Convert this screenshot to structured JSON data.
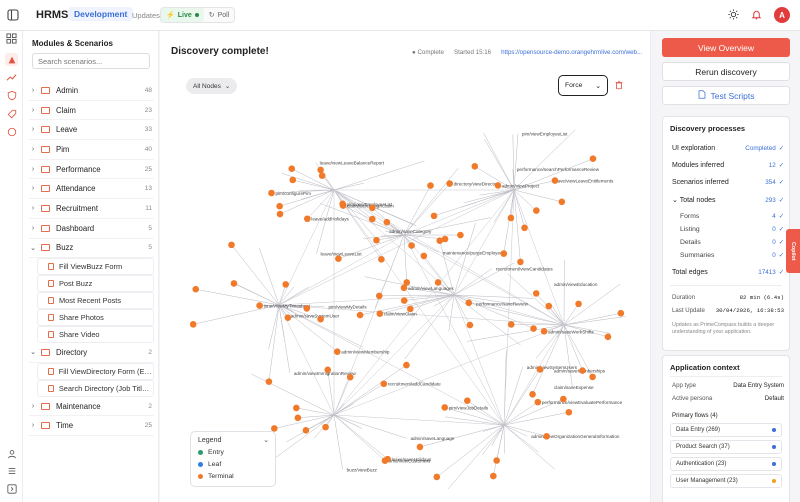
{
  "app": {
    "brand": "HRMS",
    "env": "Development",
    "updates_label": "Updates:",
    "live_label": "Live",
    "poll_label": "Poll",
    "avatar_initial": "A"
  },
  "sidebar": {
    "title": "Modules & Scenarios",
    "search_placeholder": "Search scenarios...",
    "modules": [
      {
        "name": "Admin",
        "count": "48",
        "expanded": false
      },
      {
        "name": "Claim",
        "count": "23",
        "expanded": false
      },
      {
        "name": "Leave",
        "count": "33",
        "expanded": false
      },
      {
        "name": "Pim",
        "count": "40",
        "expanded": false
      },
      {
        "name": "Performance",
        "count": "25",
        "expanded": false
      },
      {
        "name": "Attendance",
        "count": "13",
        "expanded": false
      },
      {
        "name": "Recruitment",
        "count": "11",
        "expanded": false
      },
      {
        "name": "Dashboard",
        "count": "5",
        "expanded": false
      },
      {
        "name": "Buzz",
        "count": "5",
        "expanded": true,
        "scenarios": [
          "Fill ViewBuzz Form",
          "Post Buzz",
          "Most Recent Posts",
          "Share Photos",
          "Share Video"
        ]
      },
      {
        "name": "Directory",
        "count": "2",
        "expanded": true,
        "scenarios": [
          "Fill ViewDirectory Form (Emp...",
          "Search Directory (Job Title, ..."
        ]
      },
      {
        "name": "Maintenance",
        "count": "2",
        "expanded": false
      },
      {
        "name": "Time",
        "count": "25",
        "expanded": false
      }
    ]
  },
  "main": {
    "title": "Discovery complete!",
    "status": "Complete",
    "started": "Started 15:16",
    "url": "https://opensource-demo.orangehrmlive.com/web...",
    "nodes_filter": "All Nodes",
    "layout": "Force",
    "legend": {
      "title": "Legend",
      "items": [
        {
          "label": "Entry",
          "color": "#2a9d6f"
        },
        {
          "label": "Leaf",
          "color": "#2f7fe0"
        },
        {
          "label": "Terminal",
          "color": "#f07a2a"
        }
      ]
    },
    "graph_labels": [
      "pim/configurePim",
      "leave/viewLeaveList",
      "pim/viewEmployeeList",
      "leave/viewLeaveBalanceReport",
      "leave/addHolidays",
      "pim/viewEmployeeList",
      "leave/viewLeaveEntitlements",
      "performance/searchPerformanceReview",
      "admin/viewProject",
      "pim/viewMyDetails",
      "admin/viewMembership",
      "admin/viewImmigrationReview",
      "time/viewMyTimesheet",
      "admin/saveSystemUser",
      "claim/viewClaim",
      "performance/saveReview",
      "admin/viewLanguages",
      "recruitment/viewCandidates",
      "admin/saveWorkShifts",
      "admin/viewEducation",
      "admin/saveMemberships",
      "claim/saveExpense",
      "recruitment/addCandidate",
      "admin/saveLanguage",
      "leave/saveHolidays",
      "buzz/viewBuzz",
      "time/viewCustomers",
      "admin/viewSystemUsers",
      "pim/viewJobDetails",
      "admin/viewOrganizationGeneralInformation",
      "performance/viewEvaluatePerformance",
      "admin/saveCategory",
      "claim/viewAssignClaim",
      "maintenance/purgeEmployee",
      "directory/viewDirectory"
    ]
  },
  "right": {
    "view_overview": "View Overview",
    "rerun": "Rerun discovery",
    "test_scripts": "Test Scripts",
    "processes_title": "Discovery processes",
    "ui_exploration_label": "UI exploration",
    "ui_exploration_value": "Completed",
    "modules_label": "Modules inferred",
    "modules_value": "12",
    "scenarios_label": "Scenarios inferred",
    "scenarios_value": "354",
    "total_nodes_label": "Total nodes",
    "total_nodes_value": "293",
    "forms_label": "Forms",
    "forms_value": "4",
    "listing_label": "Listing",
    "listing_value": "0",
    "details_label": "Details",
    "details_value": "0",
    "summaries_label": "Summaries",
    "summaries_value": "0",
    "total_edges_label": "Total edges",
    "total_edges_value": "17413",
    "duration_label": "Duration",
    "duration_value": "82 min (6.4s)",
    "last_update_label": "Last Update",
    "last_update_value": "30/04/2026, 16:38:53",
    "note": "Updates as PrimeCompass builds a deeper understanding of your application.",
    "context_title": "Application context",
    "app_type_label": "App type",
    "app_type_value": "Data Entry System",
    "persona_label": "Active persona",
    "persona_value": "Default",
    "flows_title": "Primary flows (4)",
    "flows": [
      {
        "label": "Data Entry (269)",
        "color": "#3b6fd6"
      },
      {
        "label": "Product Search (37)",
        "color": "#3b6fd6"
      },
      {
        "label": "Authentication (23)",
        "color": "#3b6fd6"
      },
      {
        "label": "User Management (23)",
        "color": "#f0a020"
      }
    ],
    "side_tab": "Copilot"
  }
}
